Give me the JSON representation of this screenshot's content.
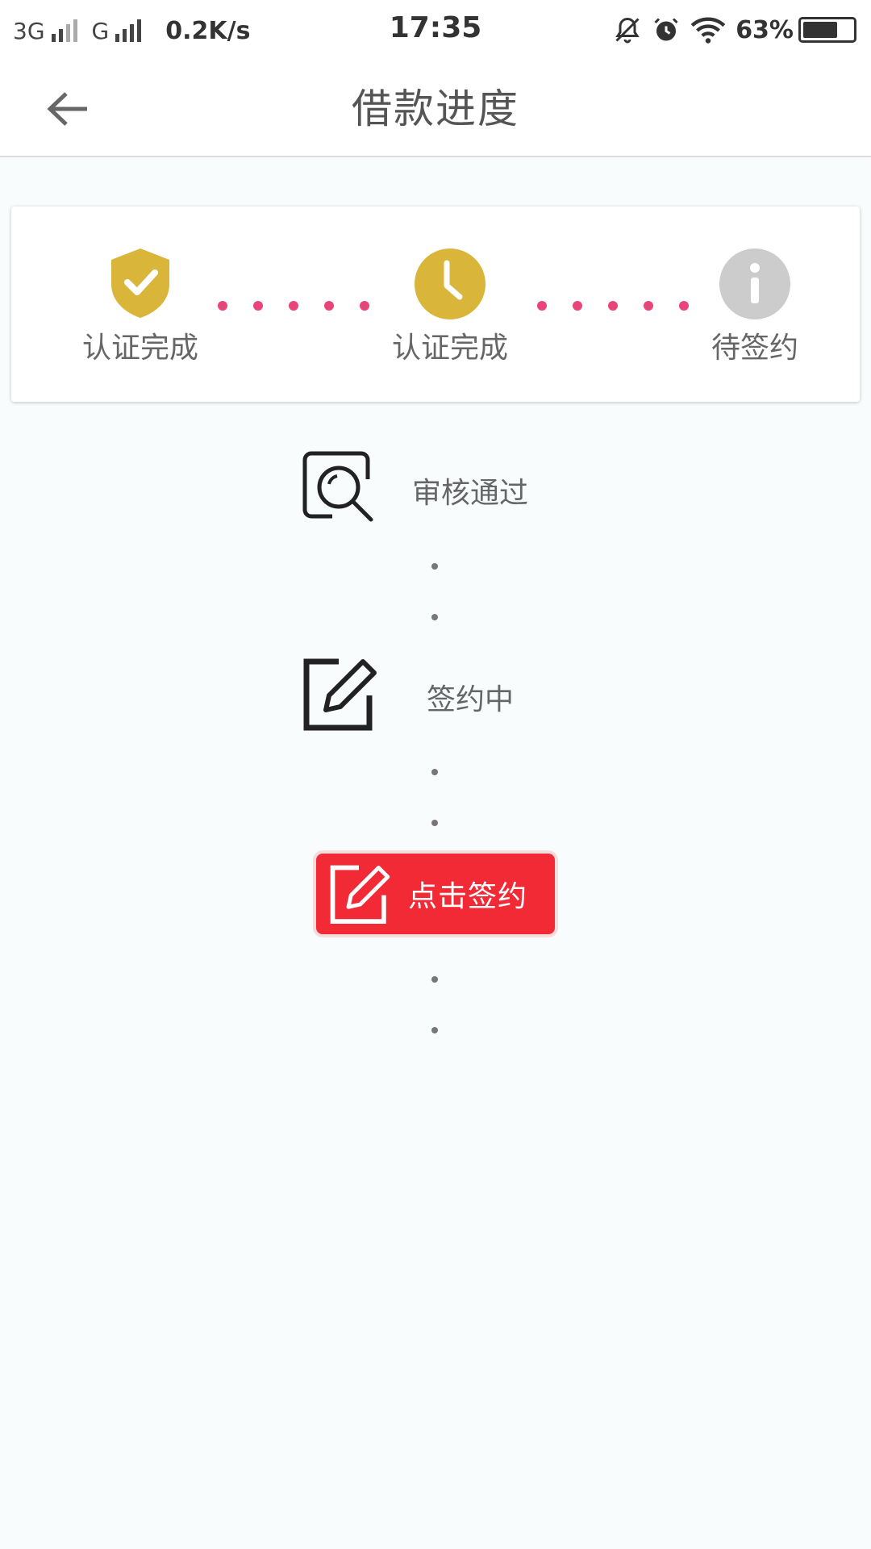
{
  "status_bar": {
    "network_1": "3G",
    "network_2": "G",
    "speed": "0.2K/s",
    "time": "17:35",
    "battery": "63%"
  },
  "header": {
    "title": "借款进度",
    "back_icon": "arrow-left-icon"
  },
  "steps": [
    {
      "label": "认证完成",
      "icon": "shield-check-icon",
      "color": "#d9b53a"
    },
    {
      "label": "认证完成",
      "icon": "clock-icon",
      "color": "#d9b53a"
    },
    {
      "label": "待签约",
      "icon": "info-icon",
      "color": "#cccccc"
    }
  ],
  "connector_color": "#e8457a",
  "process": [
    {
      "label": "审核通过",
      "icon": "review-search-icon"
    },
    {
      "label": "签约中",
      "icon": "edit-square-icon"
    }
  ],
  "sign_button": {
    "label": "点击签约",
    "icon": "edit-square-icon",
    "color": "#f22a36"
  }
}
